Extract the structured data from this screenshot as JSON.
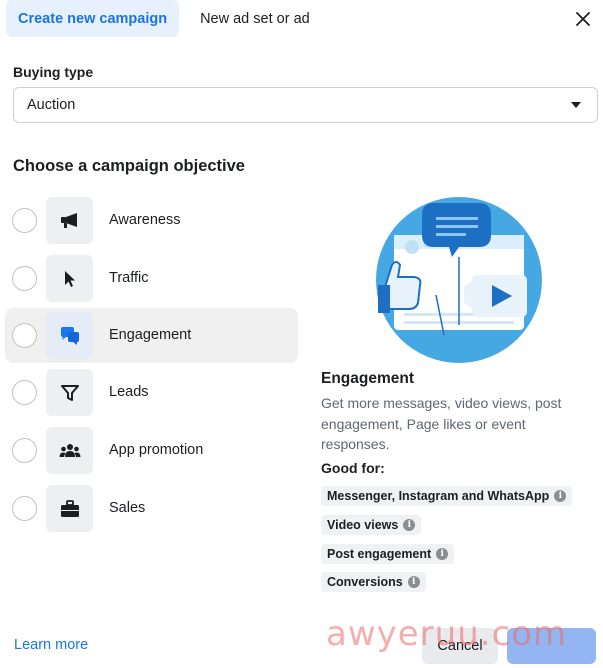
{
  "tabs": [
    {
      "label": "Create new campaign",
      "active": true
    },
    {
      "label": "New ad set or ad",
      "active": false
    }
  ],
  "close_icon": "close-icon",
  "buying_type": {
    "label": "Buying type",
    "value": "Auction",
    "icon": "dropdown-caret-icon"
  },
  "objective_heading": "Choose a campaign objective",
  "objectives": [
    {
      "label": "Awareness",
      "icon": "megaphone-icon",
      "selected": false
    },
    {
      "label": "Traffic",
      "icon": "cursor-icon",
      "selected": false
    },
    {
      "label": "Engagement",
      "icon": "chat-bubbles-icon",
      "selected": true
    },
    {
      "label": "Leads",
      "icon": "funnel-icon",
      "selected": false
    },
    {
      "label": "App promotion",
      "icon": "people-icon",
      "selected": false
    },
    {
      "label": "Sales",
      "icon": "briefcase-icon",
      "selected": false
    }
  ],
  "detail": {
    "title": "Engagement",
    "description": "Get more messages, video views, post engagement, Page likes or event responses.",
    "good_for_label": "Good for:",
    "good_for": [
      "Messenger, Instagram and WhatsApp",
      "Video views",
      "Post engagement",
      "Conversions"
    ]
  },
  "footer": {
    "learn_more": "Learn more",
    "cancel": "Cancel"
  },
  "watermark": "awyeruu.com",
  "colors": {
    "accent": "#1b74e4",
    "tab_active_bg": "#e7f0fd",
    "selected_row_bg": "#f0f0f1",
    "engagement_icon": "#1877f2"
  }
}
